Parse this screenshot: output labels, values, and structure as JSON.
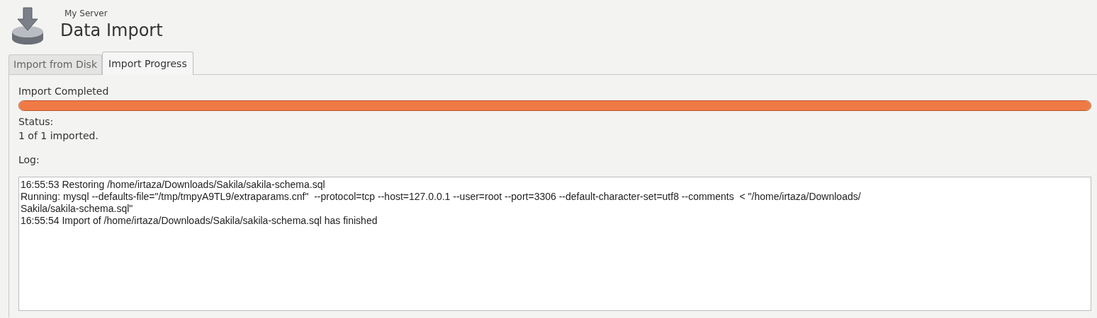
{
  "header": {
    "subtitle": "My Server",
    "title": "Data Import"
  },
  "tabs": [
    {
      "label": "Import from Disk",
      "selected": false
    },
    {
      "label": "Import Progress",
      "selected": true
    }
  ],
  "progress": {
    "label": "Import Completed",
    "level": 1
  },
  "status": {
    "label": "Status:",
    "value": "1 of 1 imported."
  },
  "log": {
    "label": "Log:",
    "text": "16:55:53 Restoring /home/irtaza/Downloads/Sakila/sakila-schema.sql\nRunning: mysql --defaults-file=\"/tmp/tmpyA9TL9/extraparams.cnf\"  --protocol=tcp --host=127.0.0.1 --user=root --port=3306 --default-character-set=utf8 --comments  < \"/home/irtaza/Downloads/\nSakila/sakila-schema.sql\"\n16:55:54 Import of /home/irtaza/Downloads/Sakila/sakila-schema.sql has finished"
  }
}
